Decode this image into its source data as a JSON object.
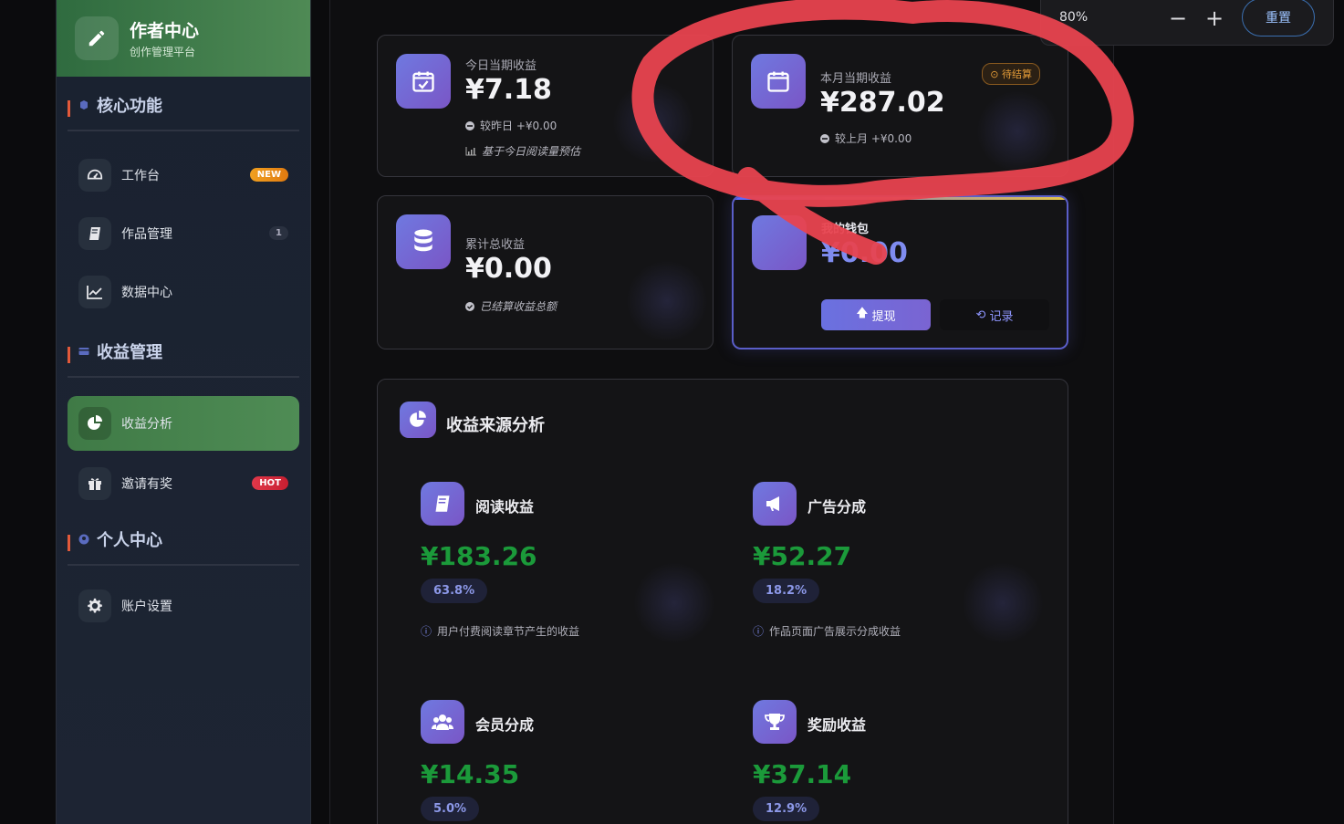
{
  "brand": {
    "title": "作者中心",
    "subtitle": "创作管理平台"
  },
  "sidebar": {
    "sections": [
      {
        "title": "核心功能"
      },
      {
        "title": "收益管理"
      },
      {
        "title": "个人中心"
      }
    ],
    "items": [
      {
        "label": "工作台",
        "badge": "NEW",
        "icon": "gauge-icon"
      },
      {
        "label": "作品管理",
        "badge": "1",
        "icon": "book-icon"
      },
      {
        "label": "数据中心",
        "icon": "chart-line-icon"
      },
      {
        "label": "收益分析",
        "icon": "pie-chart-icon",
        "active": true
      },
      {
        "label": "邀请有奖",
        "badge": "HOT",
        "icon": "gift-icon"
      },
      {
        "label": "账户设置",
        "icon": "gear-icon"
      }
    ]
  },
  "stats": {
    "today": {
      "label": "今日当期收益",
      "value": "¥7.18",
      "compare": "较昨日 +¥0.00",
      "note": "基于今日阅读量预估"
    },
    "month": {
      "label": "本月当期收益",
      "value": "¥287.02",
      "compare": "较上月 +¥0.00",
      "status": "待结算"
    },
    "total": {
      "label": "累计总收益",
      "value": "¥0.00",
      "note": "已结算收益总额"
    },
    "wallet": {
      "label": "我的钱包",
      "value": "¥0.00",
      "withdraw": "提现",
      "records": "记录"
    }
  },
  "sources": {
    "title": "收益来源分析",
    "items": [
      {
        "name": "阅读收益",
        "value": "¥183.26",
        "percent": "63.8%",
        "desc": "用户付费阅读章节产生的收益",
        "icon": "book-icon"
      },
      {
        "name": "广告分成",
        "value": "¥52.27",
        "percent": "18.2%",
        "desc": "作品页面广告展示分成收益",
        "icon": "megaphone-icon"
      },
      {
        "name": "会员分成",
        "value": "¥14.35",
        "percent": "5.0%",
        "icon": "users-icon"
      },
      {
        "name": "奖励收益",
        "value": "¥37.14",
        "percent": "12.9%",
        "icon": "trophy-icon"
      }
    ]
  },
  "zoom": {
    "level": "80%",
    "reset": "重置"
  },
  "colors": {
    "accent": "#6f79e0",
    "active_green": "#4f8c55",
    "value_green": "#1b9a3a",
    "annotation_red": "#e8434f"
  }
}
